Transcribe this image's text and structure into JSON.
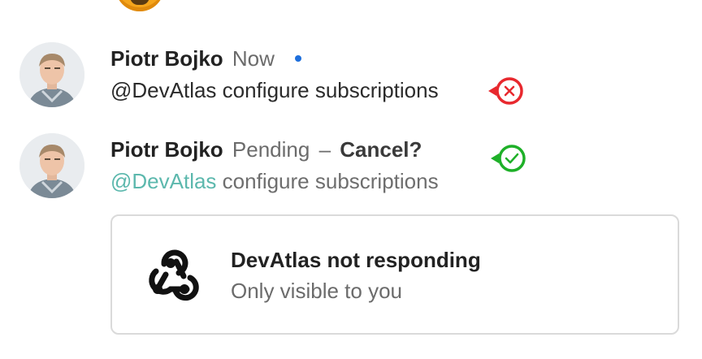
{
  "messages": [
    {
      "author": "Piotr Bojko",
      "status": "Now",
      "text": "@DevAtlas configure subscriptions",
      "delivery_icon": "error-x-icon",
      "delivery_color": "#e8282e"
    },
    {
      "author": "Piotr Bojko",
      "status": "Pending",
      "separator": "–",
      "cancel_label": "Cancel?",
      "mention": "@DevAtlas",
      "text": "configure subscriptions",
      "delivery_icon": "check-icon",
      "delivery_color": "#1eb028"
    }
  ],
  "card": {
    "icon": "webhook-icon",
    "title": "DevAtlas not responding",
    "subtitle": "Only visible to you"
  },
  "colors": {
    "mention": "#5cb8ad",
    "unread_dot": "#1e6fdc",
    "muted_text": "#6b6b6b"
  }
}
